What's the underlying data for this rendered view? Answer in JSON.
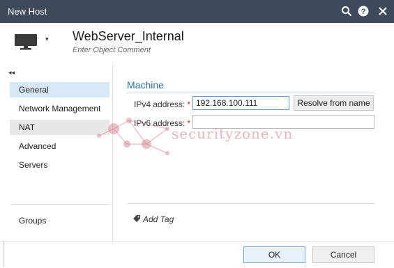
{
  "window": {
    "title": "New Host"
  },
  "titlebar_icons": [
    "search-icon",
    "help-icon",
    "close-icon"
  ],
  "header": {
    "object_name": "WebServer_Internal",
    "comment_placeholder": "Enter Object Comment"
  },
  "sidebar": {
    "collapse_glyph": "◂◂",
    "items": [
      {
        "label": "General",
        "state": "active"
      },
      {
        "label": "Network Management",
        "state": "normal"
      },
      {
        "label": "NAT",
        "state": "hover"
      },
      {
        "label": "Advanced",
        "state": "normal"
      },
      {
        "label": "Servers",
        "state": "normal"
      }
    ],
    "bottom_item": {
      "label": "Groups"
    }
  },
  "main": {
    "section_title": "Machine",
    "ipv4": {
      "label": "IPv4 address:",
      "required": "*",
      "value": "192.168.100.111"
    },
    "ipv6": {
      "label": "IPv6 address:",
      "required": "*",
      "value": ""
    },
    "resolve_button": "Resolve from name",
    "add_tag": "Add Tag"
  },
  "footer": {
    "ok": "OK",
    "cancel": "Cancel"
  },
  "watermark": {
    "text": "securityzone.vn"
  },
  "colors": {
    "titlebar": "#3d4a5c",
    "accent": "#2a6fb5",
    "required": "#d32020",
    "active_nav": "#d7e9f8"
  }
}
